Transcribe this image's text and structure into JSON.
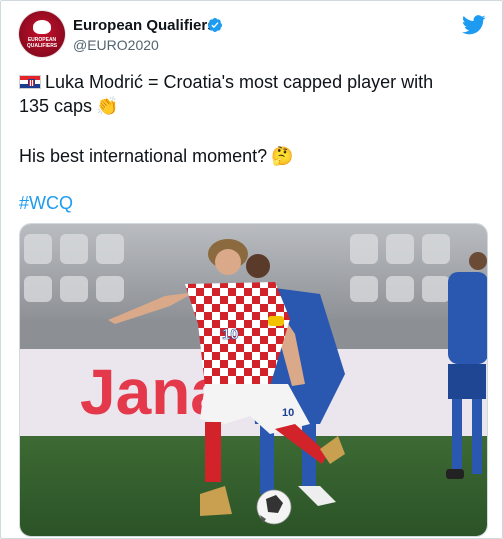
{
  "account": {
    "name": "European Qualifiers",
    "handle": "@EURO2020",
    "avatar_text": "EUROPEAN QUALIFIERS",
    "verified_icon": "verified-badge-icon",
    "platform_icon": "twitter-bird-icon"
  },
  "tweet": {
    "flag_icon": "croatia-flag-icon",
    "line1": "Luka Modrić = Croatia's most capped player with",
    "line2": "135 caps",
    "line2_emoji": "👏",
    "line3": "His best international moment?",
    "line3_emoji": "🤔",
    "hashtag": "#WCQ"
  },
  "photo": {
    "board_text": "Jana",
    "shirt_number": "10",
    "shorts_number": "10"
  },
  "colors": {
    "link": "#1d9bf0",
    "text": "#0f1419",
    "secondary": "#536471"
  }
}
